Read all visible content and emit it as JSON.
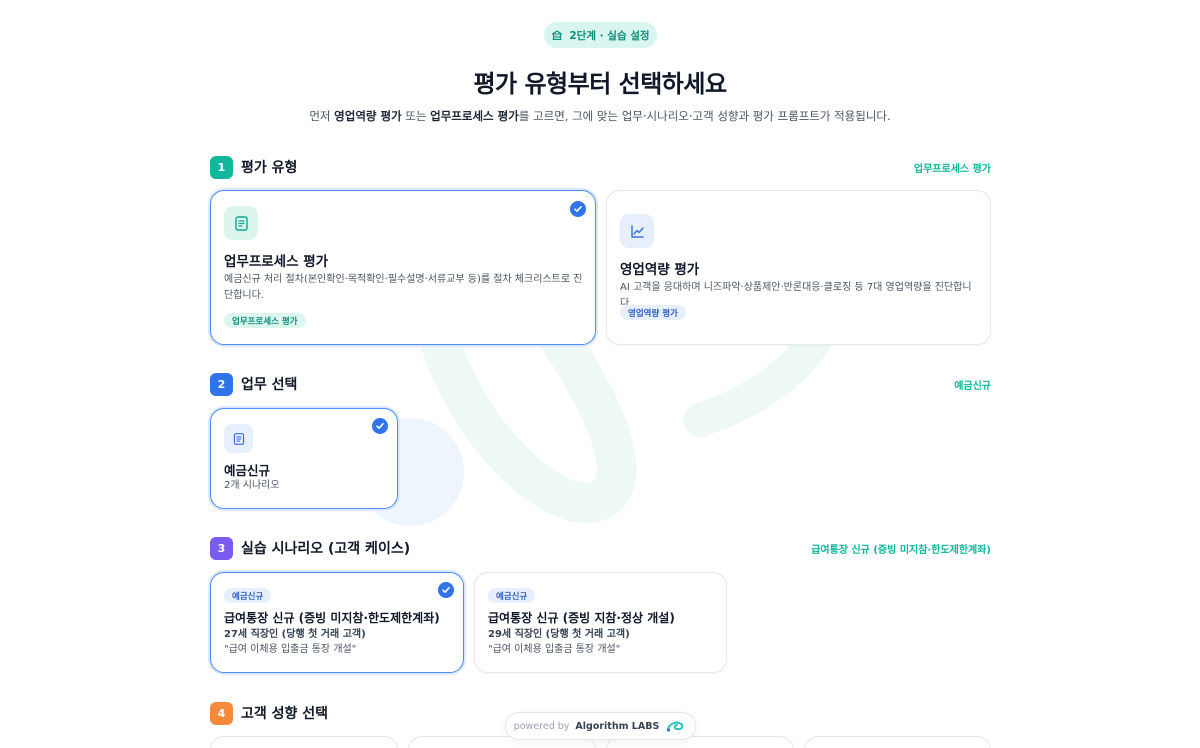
{
  "header": {
    "step_badge": "2단계 · 실습 설정",
    "title": "평가 유형부터 선택하세요",
    "subtitle": {
      "p1": "먼저 ",
      "b1": "영업역량 평가",
      "p2": " 또는 ",
      "b2": "업무프로세스 평가",
      "p3": "를 고르면, 그에 맞는 업무·시나리오·고객 성향과 평가 프롬프트가 적용됩니다."
    }
  },
  "sections": [
    {
      "num": "1",
      "title": "평가 유형",
      "selected": "업무프로세스 평가",
      "color": "#10b79b"
    },
    {
      "num": "2",
      "title": "업무 선택",
      "selected": "예금신규",
      "color": "#2f74e8"
    },
    {
      "num": "3",
      "title": "실습 시나리오 (고객 케이스)",
      "selected": "급여통장 신규 (증빙 미지참·한도제한계좌)",
      "color": "#7c5cf0"
    },
    {
      "num": "4",
      "title": "고객 성향 선택",
      "selected": "",
      "color": "#f58a3c"
    }
  ],
  "eval_types": [
    {
      "title": "업무프로세스 평가",
      "desc": "예금신규 처리 절차(본인확인·목적확인·필수설명·서류교부 등)를 절차 체크리스트로 진단합니다.",
      "tag": "업무프로세스 평가",
      "icon": "document-icon",
      "selected": true
    },
    {
      "title": "영업역량 평가",
      "desc": "AI 고객을 응대하며 니즈파악·상품제안·반론대응·클로징 등 7대 영업역량을 진단합니다.",
      "tag": "영업역량 평가",
      "icon": "chart-line-icon",
      "selected": false
    }
  ],
  "tasks": [
    {
      "title": "예금신규",
      "sub": "2개 시나리오",
      "icon": "document-icon",
      "selected": true
    }
  ],
  "scenarios": [
    {
      "tag": "예금신규",
      "title": "급여통장 신규 (증빙 미지참·한도제한계좌)",
      "persona": "27세 직장인 (당행 첫 거래 고객)",
      "quote": "\"급여 이체용 입출금 통장 개설\"",
      "selected": true
    },
    {
      "tag": "예금신규",
      "title": "급여통장 신규 (증빙 지참·정상 개설)",
      "persona": "29세 직장인 (당행 첫 거래 고객)",
      "quote": "\"급여 이체용 입출금 통장 개설\"",
      "selected": false
    }
  ],
  "footer": {
    "prefix": "powered by",
    "brand": "Algorithm LABS"
  },
  "colors": {
    "accent_teal": "#10b79b",
    "accent_blue": "#2f74e8",
    "accent_purple": "#7c5cf0",
    "accent_orange": "#f58a3c"
  }
}
